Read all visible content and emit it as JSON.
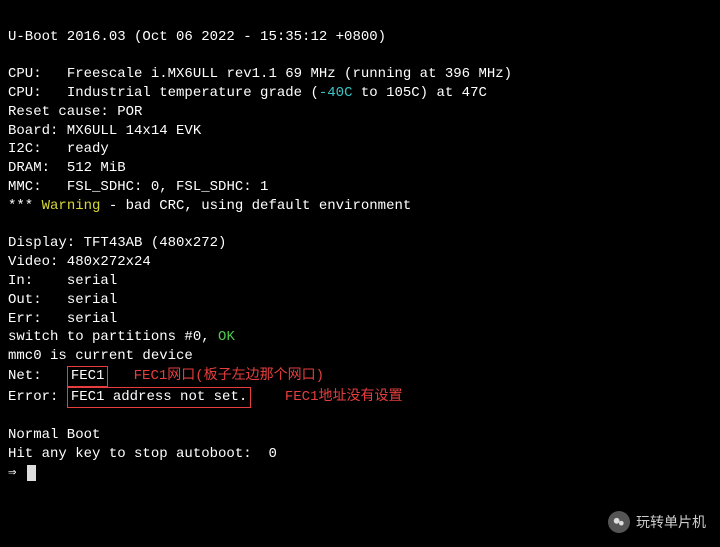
{
  "header": "U-Boot 2016.03 (Oct 06 2022 - 15:35:12 +0800)",
  "cpu1_label": "CPU:   ",
  "cpu1_text": "Freescale i.MX6ULL rev1.1 69 MHz (running at 396 MHz)",
  "cpu2_label": "CPU:   ",
  "cpu2_a": "Industrial temperature grade (",
  "cpu2_temp": "-40C",
  "cpu2_b": " to 105C) at 47C",
  "reset": "Reset cause: POR",
  "board": "Board: MX6ULL 14x14 EVK",
  "i2c_label": "I2C:   ",
  "i2c_val": "ready",
  "dram_label": "DRAM:  ",
  "dram_val": "512 MiB",
  "mmc_label": "MMC:   ",
  "mmc_val": "FSL_SDHC: 0, FSL_SDHC: 1",
  "warn_a": "*** ",
  "warn_word": "Warning",
  "warn_b": " - bad CRC, using default environment",
  "display": "Display: TFT43AB (480x272)",
  "video": "Video: 480x272x24",
  "in_label": "In:    ",
  "in_val": "serial",
  "out_label": "Out:   ",
  "out_val": "serial",
  "err_label": "Err:   ",
  "err_val": "serial",
  "switch_a": "switch to partitions #0, ",
  "switch_ok": "OK",
  "mmc0": "mmc0 is current device",
  "net_label": "Net:   ",
  "net_val": "FEC1",
  "net_gap": "   ",
  "net_annot": "FEC1网口(板子左边那个网口)",
  "error_label": "Error:",
  "error_gap1": " ",
  "error_val": "FEC1 address not set.",
  "error_gap2": "    ",
  "error_annot": "FEC1地址没有设置",
  "normal": "Normal Boot",
  "autoboot": "Hit any key to stop autoboot:  0",
  "prompt": "⇒ ",
  "watermark_text": "玩转单片机"
}
